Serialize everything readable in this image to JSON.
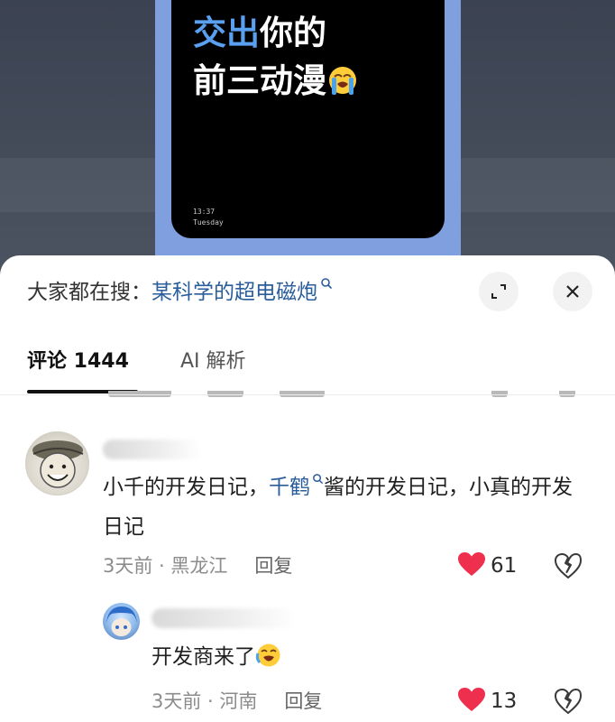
{
  "video": {
    "headline_accent": "交出",
    "headline_rest": "你的",
    "headline_line2": "前三动漫",
    "emoji": "loudly-crying-face",
    "lock_time": "13:37",
    "lock_day": "Tuesday",
    "colors": {
      "accent": "#5aa0f0",
      "frame": "#7f9fdf"
    }
  },
  "sheet": {
    "search_prefix": "大家都在搜：",
    "search_term": "某科学的超电磁炮",
    "search_icon": "search-icon",
    "expand_icon": "expand-icon",
    "close_icon": "close-icon"
  },
  "tabs": [
    {
      "label": "评论 1444",
      "active": true
    },
    {
      "label": "AI 解析",
      "active": false
    }
  ],
  "comments": [
    {
      "text_before": "小千的开发日记，",
      "mention": "千鹤",
      "text_after": "酱的开发日记，小真的开发日记",
      "time": "3天前",
      "location": "黑龙江",
      "reply_label": "回复",
      "likes": "61",
      "liked": true
    },
    {
      "text": "开发商来了",
      "emoji": "crying-face",
      "time": "3天前",
      "location": "河南",
      "reply_label": "回复",
      "likes": "13",
      "liked": true
    }
  ],
  "colors": {
    "link": "#2a5d9b",
    "heart": "#ee2f4d",
    "meta": "#8c8c8c"
  }
}
